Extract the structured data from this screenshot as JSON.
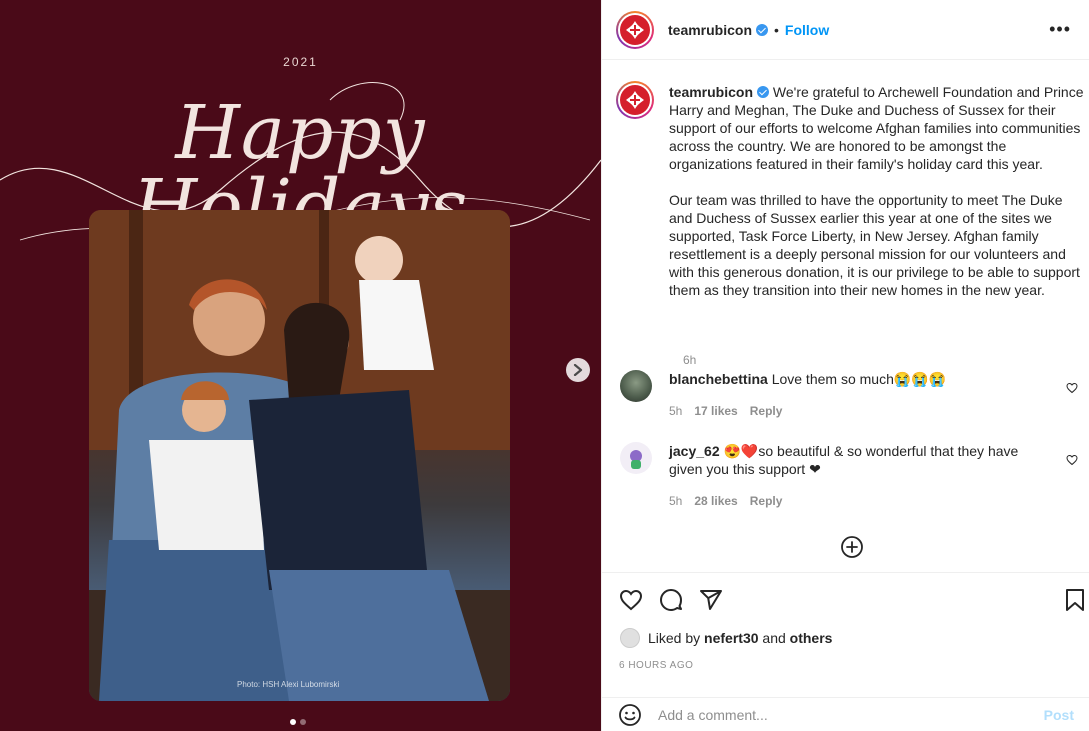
{
  "media": {
    "card_year": "2021",
    "card_heading": "Happy Holidays",
    "photo_credit": "Photo: HSH Alexi Lubomirski",
    "slide_count": 2,
    "active_slide": 1
  },
  "header": {
    "username": "teamrubicon",
    "separator": "•",
    "follow_label": "Follow",
    "more_label": "•••"
  },
  "caption": {
    "username": "teamrubicon",
    "paragraph_1": "We're grateful to Archewell Foundation and Prince Harry and Meghan, The Duke and Duchess of Sussex for their support of our efforts to welcome Afghan families into communities across the country. We are honored to be amongst the organizations featured in their family's holiday card this year.",
    "paragraph_2": "Our team was thrilled to have the opportunity to meet The Duke and Duchess of Sussex earlier this year at one of the sites we supported, Task Force Liberty, in New Jersey. Afghan family resettlement is a deeply personal mission for our volunteers and with this generous donation, it is our privilege to be able to support them as they transition into their new homes in the new year.",
    "time": "6h"
  },
  "comments": [
    {
      "username": "blanchebettina",
      "text": "Love them so much😭😭😭",
      "time": "5h",
      "likes": "17 likes",
      "reply": "Reply"
    },
    {
      "username": "jacy_62",
      "text": "😍❤️so beautiful & so wonderful that they have given you this support ❤",
      "time": "5h",
      "likes": "28 likes",
      "reply": "Reply"
    }
  ],
  "likes": {
    "prefix": "Liked by",
    "user": "nefert30",
    "joiner": "and",
    "others": "others"
  },
  "timestamp": "6 HOURS AGO",
  "add_comment": {
    "placeholder": "Add a comment...",
    "post_label": "Post"
  },
  "colors": {
    "card_background": "#4a0a18",
    "brand_red": "#d51f2c",
    "link_blue": "#0095f6",
    "post_disabled": "#b2dffc"
  }
}
